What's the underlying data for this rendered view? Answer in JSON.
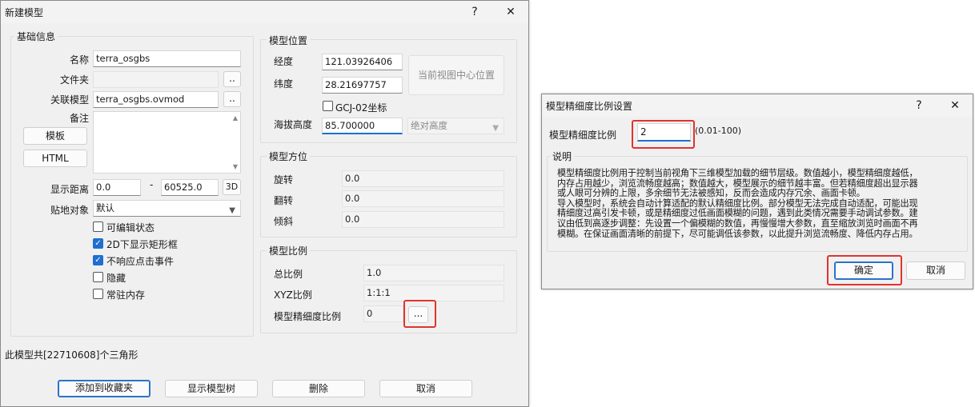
{
  "main_dialog": {
    "title": "新建模型",
    "help": "?",
    "close": "✕",
    "basic_info": {
      "legend": "基础信息",
      "name_label": "名称",
      "name_value": "terra_osgbs",
      "folder_label": "文件夹",
      "folder_value": "",
      "browse": "..",
      "linked_label": "关联模型",
      "linked_value": "terra_osgbs.ovmod",
      "remark_label": "备注",
      "template_btn": "模板",
      "html_btn": "HTML",
      "distance_label": "显示距离",
      "distance_min": "0.0",
      "distance_sep": "-",
      "distance_max": "60525.0",
      "btn_3d": "3D",
      "ground_label": "贴地对象",
      "ground_value": "默认",
      "checkboxes": [
        {
          "label": "可编辑状态",
          "checked": false
        },
        {
          "label": "2D下显示矩形框",
          "checked": true
        },
        {
          "label": "不响应点击事件",
          "checked": true
        },
        {
          "label": "隐藏",
          "checked": false
        },
        {
          "label": "常驻内存",
          "checked": false
        }
      ]
    },
    "position": {
      "legend": "模型位置",
      "lon_label": "经度",
      "lon_value": "121.03926406",
      "lat_label": "纬度",
      "lat_value": "28.21697757",
      "center_btn": "当前视图中心位置",
      "gcj_label": "GCJ-02坐标",
      "alt_label": "海拔高度",
      "alt_value": "85.700000",
      "alt_mode": "绝对高度"
    },
    "orientation": {
      "legend": "模型方位",
      "rotate_label": "旋转",
      "rotate_value": "0.0",
      "flip_label": "翻转",
      "flip_value": "0.0",
      "tilt_label": "倾斜",
      "tilt_value": "0.0"
    },
    "scale": {
      "legend": "模型比例",
      "total_label": "总比例",
      "total_value": "1.0",
      "xyz_label": "XYZ比例",
      "xyz_value": "1:1:1",
      "fine_label": "模型精细度比例",
      "fine_value": "0",
      "fine_btn": "..."
    },
    "triangle_info": "此模型共[22710608]个三角形",
    "buttons": {
      "favorite": "添加到收藏夹",
      "show_tree": "显示模型树",
      "delete": "删除",
      "cancel": "取消"
    }
  },
  "fine_dialog": {
    "title": "模型精细度比例设置",
    "help": "?",
    "close": "✕",
    "ratio_label": "模型精细度比例",
    "ratio_value": "2",
    "ratio_range": "(0.01-100)",
    "desc_legend": "说明",
    "desc_lines": [
      "模型精细度比例用于控制当前视角下三维模型加载的细节层级。数值越小，模型精细度越低，",
      "内存占用越少，浏览流畅度越高；数值越大，模型展示的细节越丰富。但若精细度超出显示器",
      "或人眼可分辨的上限，多余细节无法被感知，反而会造成内存冗余、画面卡顿。",
      "导入模型时，系统会自动计算适配的默认精细度比例。部分模型无法完成自动适配，可能出现",
      "精细度过高引发卡顿，或是精细度过低画面模糊的问题，遇到此类情况需要手动调试参数。建",
      "议由低到高逐步调整：先设置一个偏模糊的数值，再慢慢增大参数，直至缩放浏览时画面不再",
      "模糊。在保证画面清晰的前提下，尽可能调低该参数，以此提升浏览流畅度、降低内存占用。"
    ],
    "ok": "确定",
    "cancel": "取消"
  }
}
